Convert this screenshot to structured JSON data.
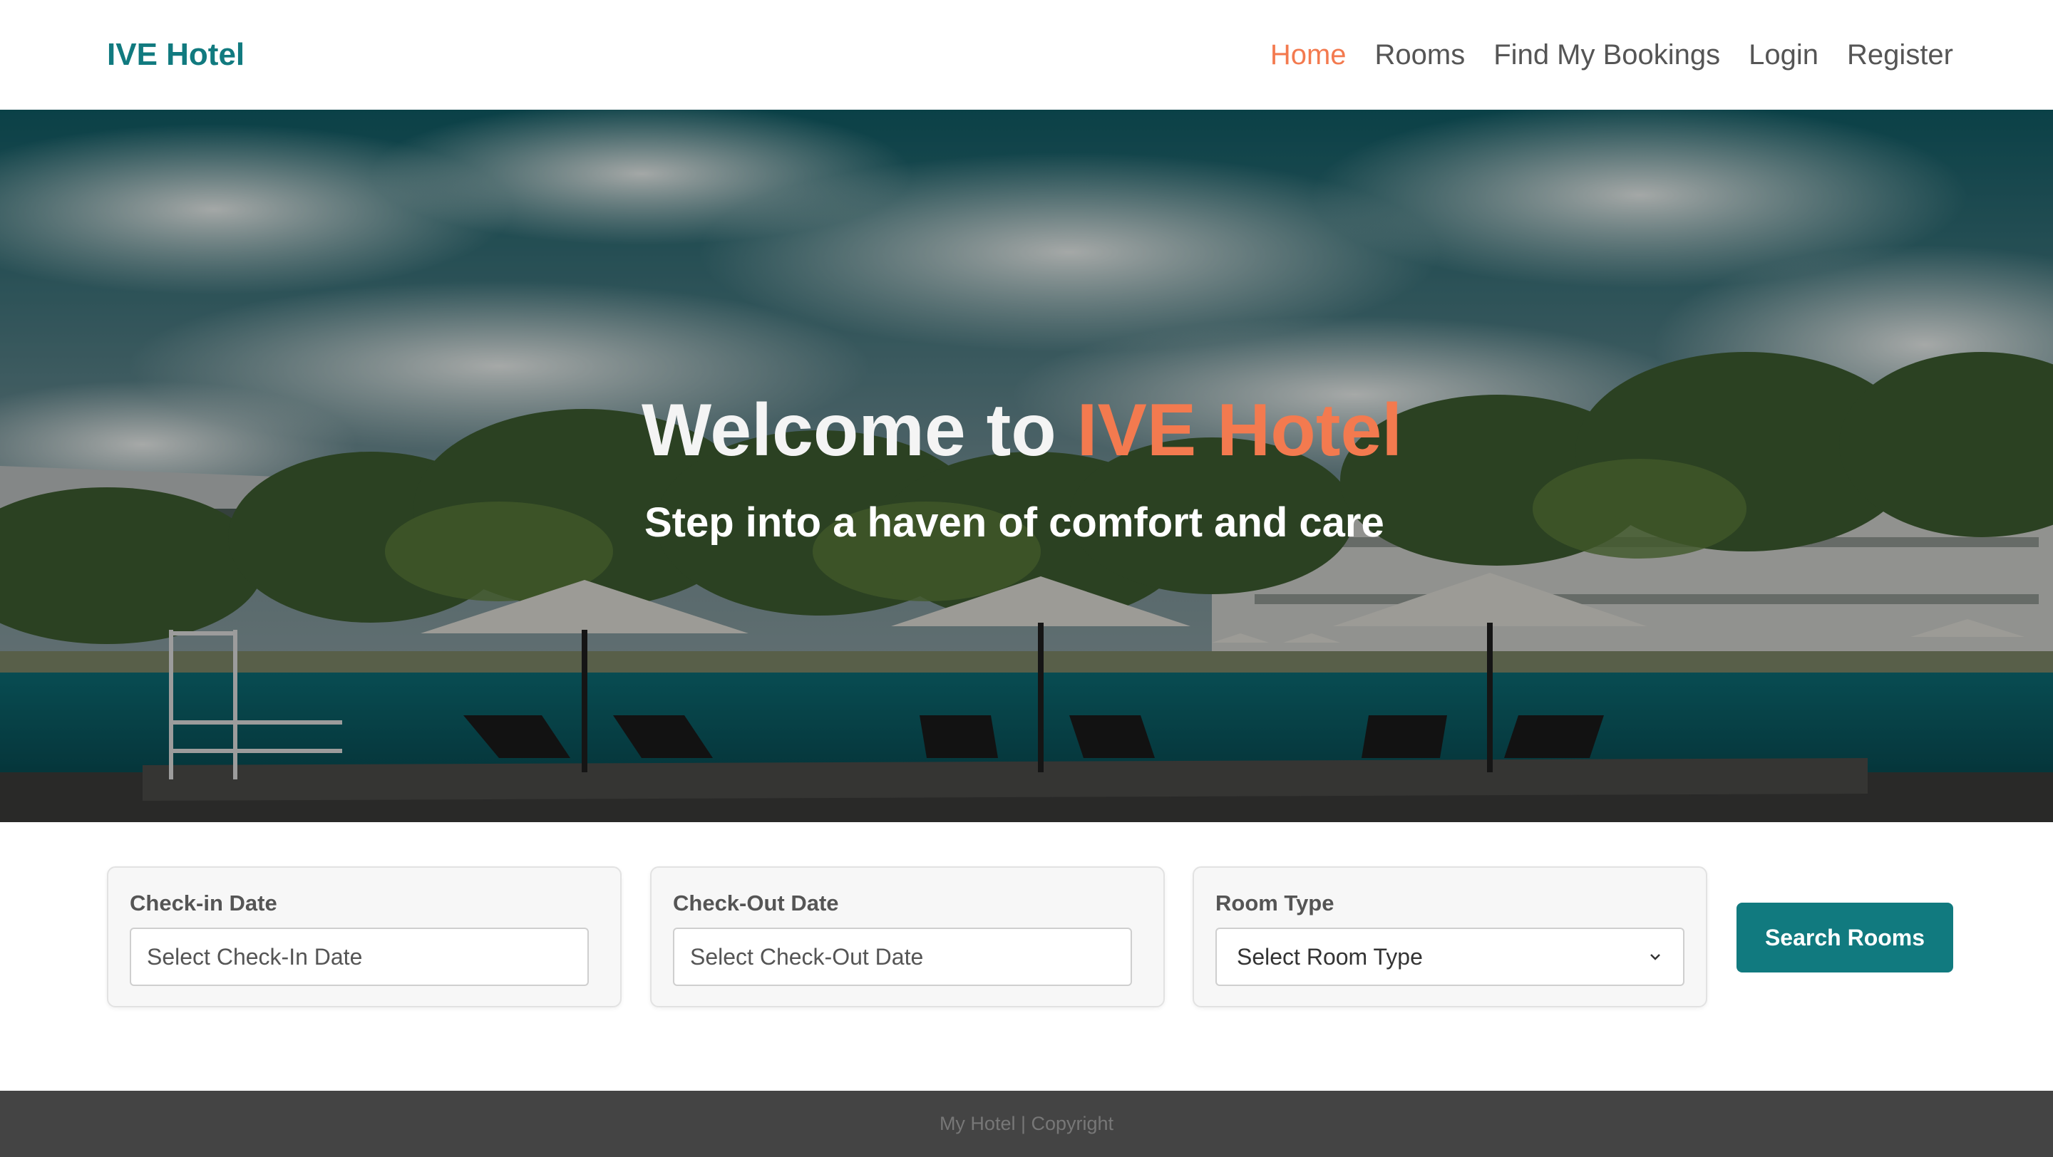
{
  "navbar": {
    "brand": "IVE Hotel",
    "links": [
      {
        "label": "Home",
        "active": true
      },
      {
        "label": "Rooms",
        "active": false
      },
      {
        "label": "Find My Bookings",
        "active": false
      },
      {
        "label": "Login",
        "active": false
      },
      {
        "label": "Register",
        "active": false
      }
    ]
  },
  "hero": {
    "title_prefix": "Welcome to",
    "title_accent": "IVE Hotel",
    "subtitle": "Step into a haven of comfort and care",
    "translate_icon": "translate-icon"
  },
  "search": {
    "checkin": {
      "label": "Check-in Date",
      "placeholder": "Select Check-In Date"
    },
    "checkout": {
      "label": "Check-Out Date",
      "placeholder": "Select Check-Out Date"
    },
    "room_type": {
      "label": "Room Type",
      "selected": "Select Room Type",
      "icon": "chevron-down-icon"
    },
    "button_label": "Search Rooms"
  },
  "footer": {
    "text": "My Hotel | Copyright"
  },
  "colors": {
    "brand": "#117a7f",
    "accent": "#f37a4f",
    "nav_text": "#555555",
    "footer_bg": "#444444"
  }
}
